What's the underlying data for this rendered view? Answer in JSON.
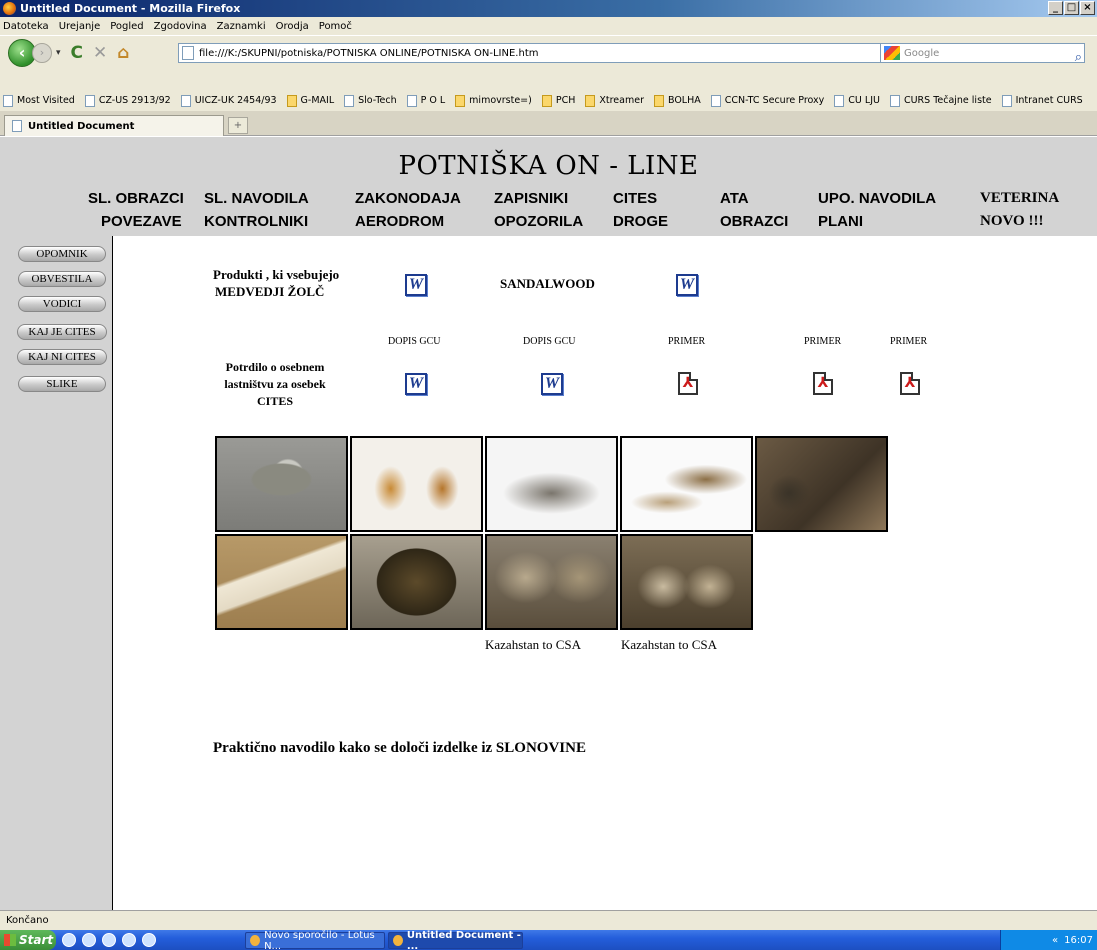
{
  "window": {
    "title": "Untitled Document - Mozilla Firefox",
    "controls": [
      "_",
      "□",
      "×"
    ]
  },
  "menu": [
    "Datoteka",
    "Urejanje",
    "Pogled",
    "Zgodovina",
    "Zaznamki",
    "Orodja",
    "Pomoč"
  ],
  "toolbar": {
    "url": "file:///K:/SKUPNI/potniska/POTNISKA ONLINE/POTNISKA ON-LINE.htm",
    "search_placeholder": "Google"
  },
  "bookmarks": [
    {
      "label": "Most Visited",
      "icon": "bookmark-icon"
    },
    {
      "label": "CZ-US 2913/92",
      "icon": "page-icon"
    },
    {
      "label": "UICZ-UK 2454/93",
      "icon": "page-icon"
    },
    {
      "label": "G-MAIL",
      "icon": "gmail-icon"
    },
    {
      "label": "Slo-Tech",
      "icon": "monitor-icon"
    },
    {
      "label": "P O L",
      "icon": "page-icon"
    },
    {
      "label": "mimovrste=)",
      "icon": "shop-icon"
    },
    {
      "label": "PCH",
      "icon": "pch-icon"
    },
    {
      "label": "Xtreamer",
      "icon": "x-icon"
    },
    {
      "label": "BOLHA",
      "icon": "bolha-icon"
    },
    {
      "label": "CCN-TC Secure Proxy",
      "icon": "page-icon"
    },
    {
      "label": "CU LJU",
      "icon": "page-icon"
    },
    {
      "label": "CURS Tečajne liste",
      "icon": "page-icon"
    },
    {
      "label": "Intranet CURS",
      "icon": "page-icon"
    }
  ],
  "tab": {
    "label": "Untitled Document"
  },
  "site": {
    "title": "POTNIŠKA  ON - LINE",
    "nav": [
      {
        "label": "SL. OBRAZCI"
      },
      {
        "label": "POVEZAVE"
      },
      {
        "label": "SL. NAVODILA"
      },
      {
        "label": "KONTROLNIKI"
      },
      {
        "label": "ZAKONODAJA"
      },
      {
        "label": "AERODROM"
      },
      {
        "label": "ZAPISNIKI"
      },
      {
        "label": "OPOZORILA"
      },
      {
        "label": "CITES"
      },
      {
        "label": "DROGE"
      },
      {
        "label": "ATA"
      },
      {
        "label": "OBRAZCI"
      },
      {
        "label": "UPO. NAVODILA"
      },
      {
        "label": "PLANI"
      },
      {
        "label": "VETERINA"
      },
      {
        "label": "NOVO !!!"
      }
    ]
  },
  "sidebar": [
    "OPOMNIK",
    "OBVESTILA",
    "VODICI",
    "KAJ JE CITES",
    "KAJ NI CITES",
    "SLIKE"
  ],
  "content": {
    "row1": {
      "text_line1": "Produkti , ki vsebujejo",
      "text_line2": "MEDVEDJI ŽOLČ",
      "sandalwood": "SANDALWOOD"
    },
    "row2": {
      "labels": [
        "DOPIS GCU",
        "DOPIS GCU",
        "PRIMER",
        "PRIMER",
        "PRIMER"
      ],
      "text_lines": [
        "Potrdilo o osebnem",
        "lastništvu za osebek",
        "CITES"
      ]
    },
    "photos": [
      {
        "name": "turtle-coin-photo"
      },
      {
        "name": "bottles-photo"
      },
      {
        "name": "bags-photo"
      },
      {
        "name": "shoes-photo"
      },
      {
        "name": "boxes-photo"
      },
      {
        "name": "ivory-photo"
      },
      {
        "name": "mask-photo"
      },
      {
        "name": "wolf-skins-photo"
      },
      {
        "name": "wolf-heads-photo"
      }
    ],
    "captions": [
      "Kazahstan to CSA",
      "Kazahstan to CSA"
    ],
    "footer_link": "Praktično navodilo kako se določi izdelke iz SLONOVINE"
  },
  "status": {
    "text": "Končano"
  },
  "taskbar": {
    "start": "Start",
    "items": [
      "Novo sporočilo - Lotus N...",
      "Untitled Document - ..."
    ],
    "clock": "16:07"
  },
  "colors": {
    "header_bg": "#d3d3d3",
    "word_icon": "#1d3b8f",
    "pdf_icon": "#cc1a1a"
  }
}
